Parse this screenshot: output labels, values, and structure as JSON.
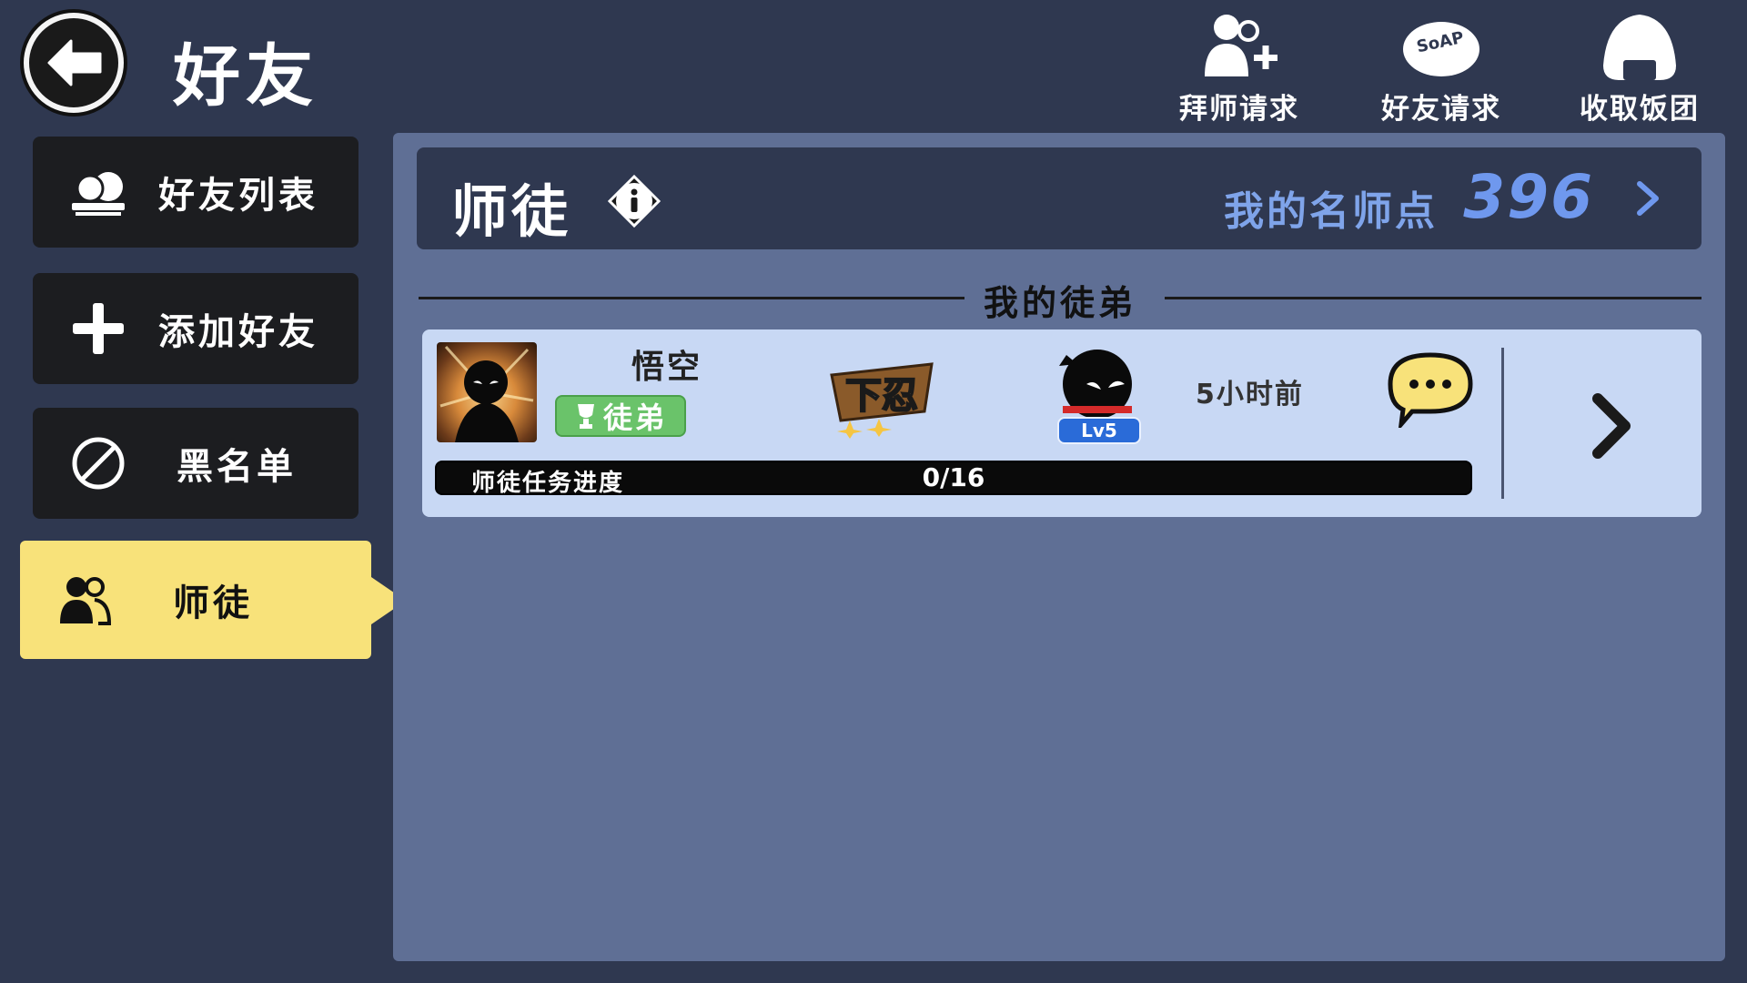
{
  "header": {
    "title": "好友",
    "actions": [
      {
        "label": "拜师请求",
        "icon": "add-user-icon"
      },
      {
        "label": "好友请求",
        "icon": "soap-icon"
      },
      {
        "label": "收取饭团",
        "icon": "rice-ball-icon"
      }
    ]
  },
  "sidebar": {
    "items": [
      {
        "label": "好友列表",
        "icon": "friends-icon",
        "active": false
      },
      {
        "label": "添加好友",
        "icon": "plus-icon",
        "active": false
      },
      {
        "label": "黑名单",
        "icon": "block-icon",
        "active": false
      },
      {
        "label": "师徒",
        "icon": "master-disciple-icon",
        "active": true
      }
    ]
  },
  "main": {
    "title": "师徒",
    "points_label": "我的名师点",
    "points_value": "396",
    "section_title": "我的徒弟",
    "disciples": [
      {
        "name": "悟空",
        "role": "徒弟",
        "rank_logo_text": "下忍",
        "level": "Lv5",
        "last_seen": "5小时前",
        "progress_label": "师徒任务进度",
        "progress_text": "0/16",
        "progress_fraction": 0
      }
    ]
  },
  "colors": {
    "background": "#2f3850",
    "panel": "#5f6f95",
    "active_tab": "#f8e27a",
    "points": "#6f98ee",
    "card": "#c8d8f4",
    "role_badge": "#6ac36a",
    "level_badge": "#2a6bd8"
  }
}
